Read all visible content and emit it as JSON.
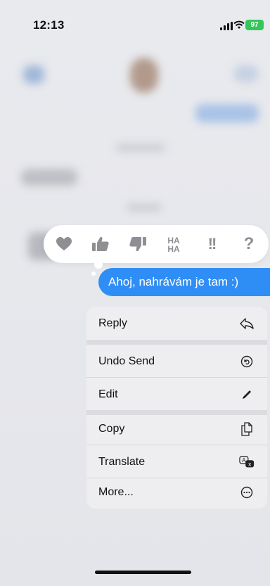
{
  "status_bar": {
    "time": "12:13",
    "battery": "97"
  },
  "reactions": [
    {
      "name": "heart-reaction",
      "icon": "heart-icon"
    },
    {
      "name": "thumbs-up-reaction",
      "icon": "thumbs-up-icon"
    },
    {
      "name": "thumbs-down-reaction",
      "icon": "thumbs-down-icon"
    },
    {
      "name": "haha-reaction",
      "icon": "haha-icon",
      "text": "HA HA"
    },
    {
      "name": "exclamation-reaction",
      "icon": "double-exclamation-icon",
      "text": "!!"
    },
    {
      "name": "question-reaction",
      "icon": "question-icon",
      "text": "?"
    }
  ],
  "message": {
    "text": "Ahoj, nahrávám je tam :)"
  },
  "menu": {
    "items": [
      {
        "label": "Reply",
        "icon": "reply-icon"
      },
      {
        "label": "Undo Send",
        "icon": "undo-icon"
      },
      {
        "label": "Edit",
        "icon": "pencil-icon"
      },
      {
        "label": "Copy",
        "icon": "copy-icon"
      },
      {
        "label": "Translate",
        "icon": "translate-icon"
      },
      {
        "label": "More...",
        "icon": "more-icon"
      }
    ]
  },
  "colors": {
    "accent": "#2f8ef5",
    "battery": "#34c759",
    "reaction_icon": "#8e8e93"
  }
}
